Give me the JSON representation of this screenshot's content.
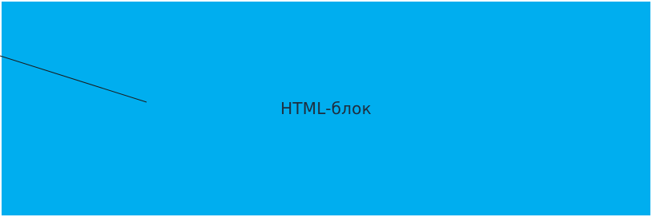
{
  "block": {
    "label": "HTML-блок"
  },
  "colors": {
    "block_background": "#00aeef",
    "label_text": "#1f2d3d",
    "connector_line": "#1a1a1a",
    "page_background": "#ffffff"
  }
}
